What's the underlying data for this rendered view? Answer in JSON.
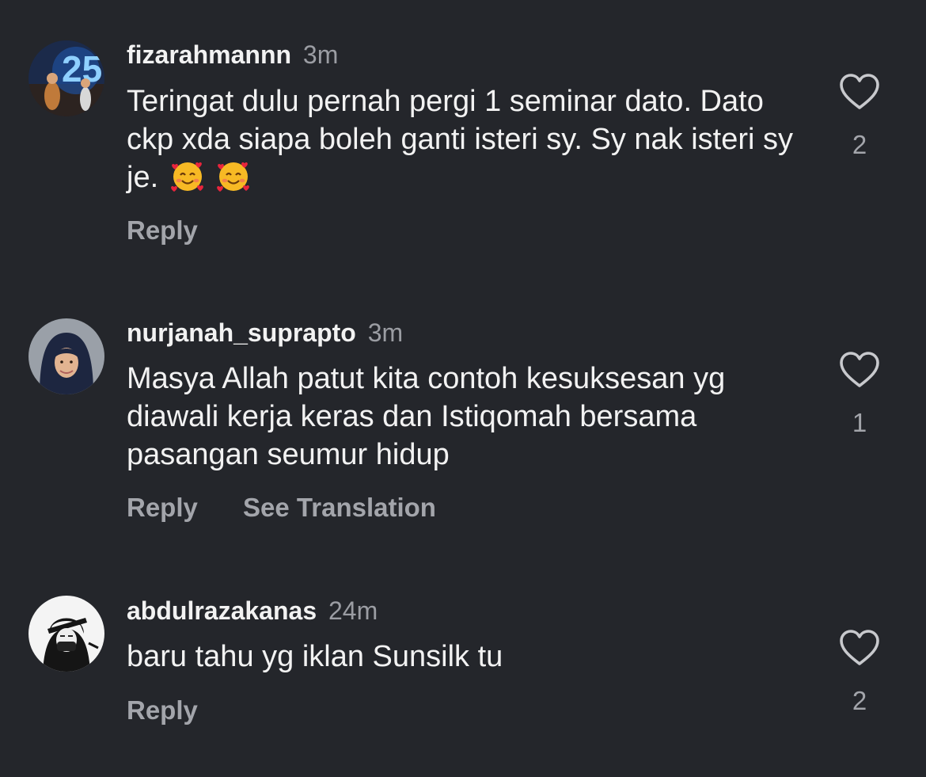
{
  "comments": [
    {
      "username": "fizarahmannn",
      "time": "3m",
      "text": "Teringat dulu pernah pergi 1 seminar dato. Dato ckp xda siapa boleh ganti isteri sy. Sy nak isteri sy je.",
      "emoji": "smiling-face-with-hearts",
      "reply_label": "Reply",
      "likes": "2"
    },
    {
      "username": "nurjanah_suprapto",
      "time": "3m",
      "text": "Masya Allah patut kita contoh kesuksesan yg diawali kerja keras dan Istiqomah bersama pasangan seumur hidup",
      "reply_label": "Reply",
      "translation_label": "See Translation",
      "likes": "1"
    },
    {
      "username": "abdulrazakanas",
      "time": "24m",
      "text": "baru tahu yg iklan Sunsilk tu",
      "reply_label": "Reply",
      "likes": "2"
    }
  ],
  "colors": {
    "background": "#24262b",
    "primary_text": "#f2f2f2",
    "secondary_text": "#a3a5ab"
  },
  "icons": {
    "like": "heart-outline-icon"
  }
}
